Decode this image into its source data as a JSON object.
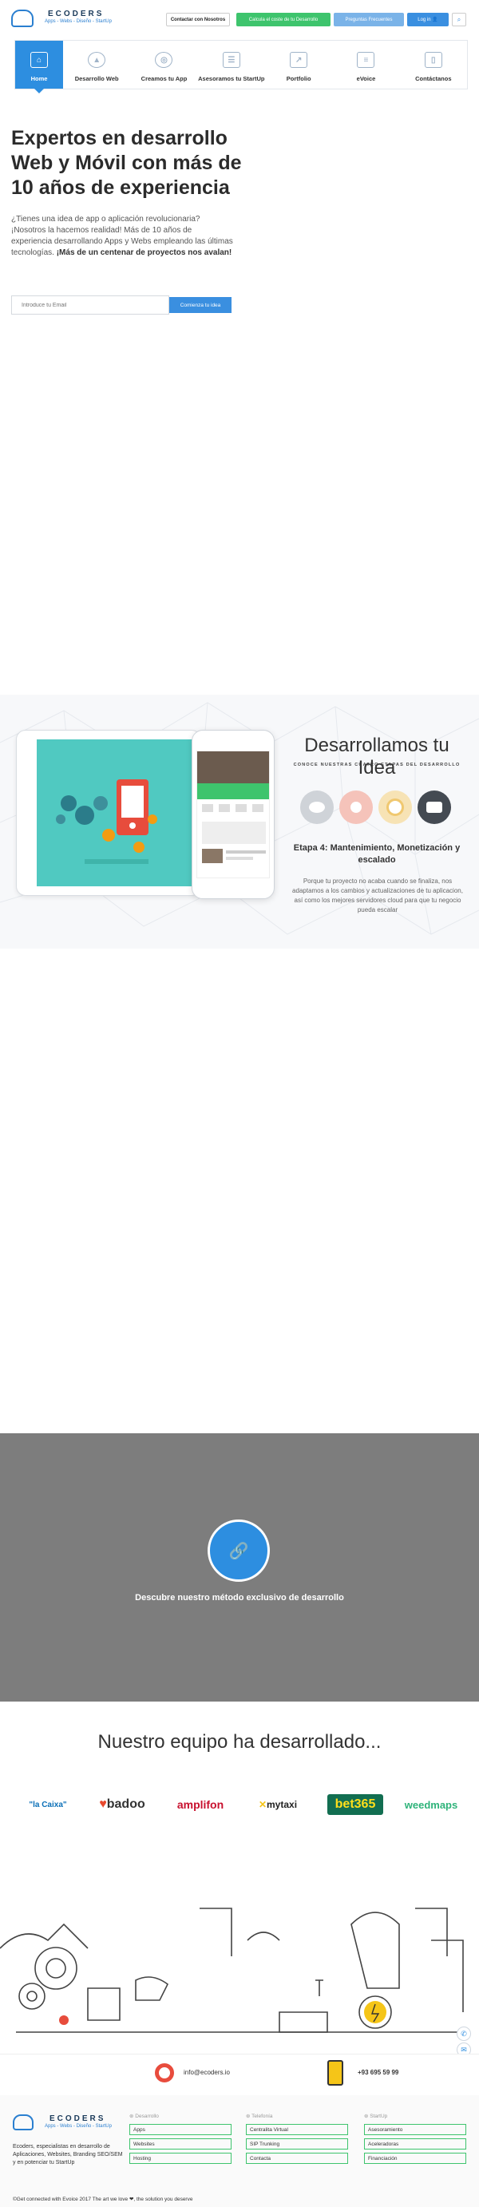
{
  "header": {
    "brand": "ECODERS",
    "tagline": "Apps - Webs - Diseño - StartUp",
    "contact": "Contactar con Nosotros",
    "calc": "Calcula el coste de tu Desarrollo",
    "faq": "Preguntas Frecuentes",
    "login": "Log in",
    "search_icon": "search-icon"
  },
  "nav": {
    "items": [
      {
        "label": "Home",
        "icon": "home-icon"
      },
      {
        "label": "Desarrollo Web",
        "icon": "rocket-icon"
      },
      {
        "label": "Creamos tu App",
        "icon": "globe-icon"
      },
      {
        "label": "Asesoramos tu StartUp",
        "icon": "chat-icon"
      },
      {
        "label": "Portfolio",
        "icon": "chart-icon"
      },
      {
        "label": "eVoice",
        "icon": "document-icon"
      },
      {
        "label": "Contáctanos",
        "icon": "phone-icon"
      }
    ]
  },
  "hero": {
    "title": "Expertos en desarrollo Web y Móvil con más de 10 años de experiencia",
    "text": "¿Tienes una idea de app o aplicación revolucionaria? ¡Nosotros la hacemos realidad! Más de 10 años de experiencia desarrollando Apps y Webs empleando las últimas tecnologías.",
    "text_bold": "¡Más de un centenar de proyectos nos avalan!",
    "email_placeholder": "Introduce tu Email",
    "cta": "Comienza tu idea"
  },
  "idea": {
    "title": "Desarrollamos tu Idea",
    "subtitle": "CONOCE NUESTRAS CUATRO ETAPAS DEL DESARROLLO",
    "stage_title": "Etapa 4: Mantenimiento, Monetización y escalado",
    "stage_text": "Porque tu proyecto no acaba cuando se finaliza, nos adaptamos a los cambios y actualizaciones de tu aplicacion, así como los mejores servidores cloud para que tu negocio pueda escalar",
    "stages": [
      {
        "icon": "eye-icon",
        "color": "#cfd3d8"
      },
      {
        "icon": "share-icon",
        "color": "#f5c3ba"
      },
      {
        "icon": "target-icon",
        "color": "#f7e3b5"
      },
      {
        "icon": "card-icon",
        "color": "#444a52"
      }
    ]
  },
  "method": {
    "text": "Descubre nuestro método exclusivo de desarrollo",
    "icon": "link-icon"
  },
  "clients": {
    "title": "Nuestro equipo ha desarrollado...",
    "logos": [
      {
        "name": "\"la Caixa\"",
        "color": "#0a6fb7"
      },
      {
        "name": "badoo",
        "color": "#e8492e"
      },
      {
        "name": "amplifon",
        "color": "#c8102e"
      },
      {
        "name": "mytaxi",
        "color": "#222222"
      },
      {
        "name": "bet365",
        "color": "#ffdf1b"
      },
      {
        "name": "weedmaps",
        "color": "#2fb37a"
      }
    ]
  },
  "contact": {
    "email": "info@ecoders.io",
    "phone": "+93 695 59 99"
  },
  "footer": {
    "brand": "ECODERS",
    "tagline": "Apps - Webs - Diseño - StartUp",
    "description": "Ecoders, especialistas en desarrollo de Aplicaciones, Websites, Branding SEO/SEM y en potenciar tu StartUp",
    "columns": [
      {
        "heading": "Desarrollo",
        "links": [
          "Apps",
          "Websites",
          "Hosting"
        ]
      },
      {
        "heading": "Telefonía",
        "links": [
          "Centralita Virtual",
          "SIP Trunking",
          "Contacta"
        ]
      },
      {
        "heading": "StartUp",
        "links": [
          "Asesoramiento",
          "Aceleradoras",
          "Financiación"
        ]
      }
    ],
    "bottom": "©Get connected with Evoice 2017 The art we love ❤, the solution you deserve"
  }
}
